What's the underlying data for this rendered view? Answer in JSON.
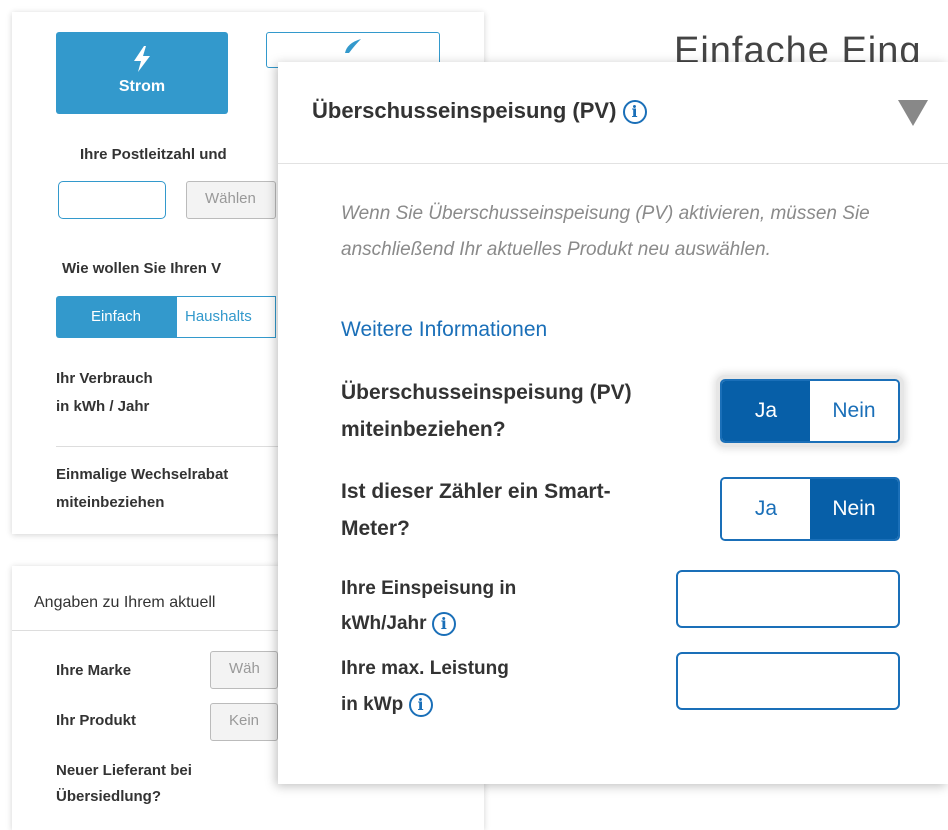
{
  "background": {
    "tariff_types": {
      "strom_label": "Strom"
    },
    "postcode_prompt": "Ihre Postleitzahl und",
    "postcode_select": "Wählen",
    "consumption_prompt": "Wie wollen Sie Ihren V",
    "mode_tabs": [
      "Einfach",
      "Haushalts"
    ],
    "consumption_label_1": "Ihr Verbrauch",
    "consumption_label_2": "in kWh / Jahr",
    "rebate_label_1": "Einmalige Wechselrabat",
    "rebate_label_2": "miteinbeziehen",
    "heading_fragment": "Einfache Eing",
    "current_section_title": "Angaben zu Ihrem aktuell",
    "brand_label": "Ihre Marke",
    "brand_select": "Wäh",
    "product_label": "Ihr Produkt",
    "product_select": "Kein",
    "move_label_1": "Neuer Lieferant bei",
    "move_label_2": "Übersiedlung?"
  },
  "panel": {
    "title": "Überschusseinspeisung (PV)",
    "info_icon": "i",
    "note": "Wenn Sie Überschusseinspeisung (PV) aktivieren, müssen Sie anschließend Ihr aktuelles Produkt neu auswählen.",
    "more_info_link": "Weitere Informationen",
    "q_pv_1": "Überschusseinspeisung (PV)",
    "q_pv_2": "miteinbeziehen?",
    "q_pv_options": {
      "yes": "Ja",
      "no": "Nein",
      "selected": "yes"
    },
    "q_smart_1": "Ist dieser Zähler ein Smart-",
    "q_smart_2": "Meter?",
    "q_smart_options": {
      "yes": "Ja",
      "no": "Nein",
      "selected": "no"
    },
    "feed_in_label_1": "Ihre Einspeisung in",
    "feed_in_label_2": "kWh/Jahr",
    "max_power_label_1": "Ihre max. Leistung",
    "max_power_label_2": "in kWp"
  },
  "colors": {
    "accent": "#3399cc",
    "primary": "#075fa8",
    "link": "#1a6fb8"
  }
}
